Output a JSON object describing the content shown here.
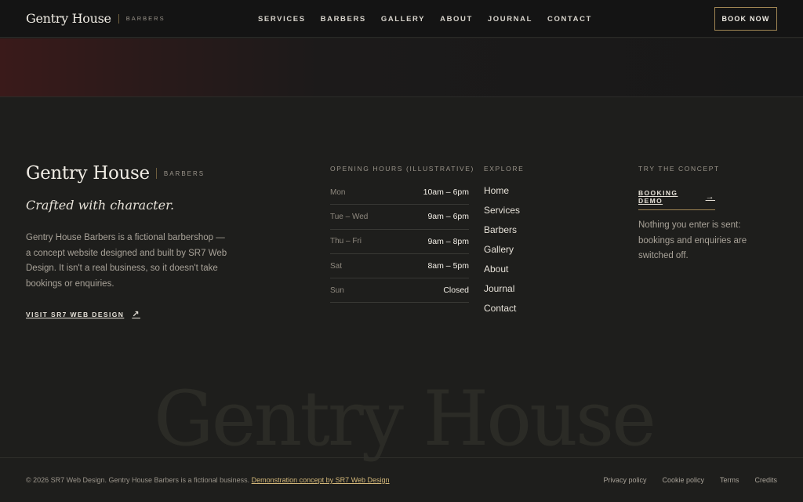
{
  "header": {
    "brand_name": "Gentry House",
    "brand_sub": "BARBERS",
    "nav": [
      "SERVICES",
      "BARBERS",
      "GALLERY",
      "ABOUT",
      "JOURNAL",
      "CONTACT"
    ],
    "book_label": "BOOK NOW"
  },
  "footer": {
    "brand_name": "Gentry House",
    "brand_sub": "BARBERS",
    "tagline": "Crafted with character.",
    "about": "Gentry House Barbers is a fictional barbershop — a concept website designed and built by SR7 Web Design. It isn't a real business, so it doesn't take bookings or enquiries.",
    "visit_label": "VISIT SR7 WEB DESIGN",
    "hours_title": "OPENING HOURS (ILLUSTRATIVE)",
    "hours": [
      {
        "day": "Mon",
        "time": "10am – 6pm"
      },
      {
        "day": "Tue – Wed",
        "time": "9am – 6pm"
      },
      {
        "day": "Thu – Fri",
        "time": "9am – 8pm"
      },
      {
        "day": "Sat",
        "time": "8am – 5pm"
      },
      {
        "day": "Sun",
        "time": "Closed"
      }
    ],
    "explore_title": "EXPLORE",
    "explore": [
      "Home",
      "Services",
      "Barbers",
      "Gallery",
      "About",
      "Journal",
      "Contact"
    ],
    "concept_title": "TRY THE CONCEPT",
    "demo_label": "BOOKING DEMO",
    "concept_note": "Nothing you enter is sent: bookings and enquiries are switched off.",
    "watermark": "Gentry House"
  },
  "bottom": {
    "copyright": "© 2026 SR7 Web Design. Gentry House Barbers is a fictional business.",
    "demo_link": "Demonstration concept by SR7 Web Design",
    "legal": [
      "Privacy policy",
      "Cookie policy",
      "Terms",
      "Credits"
    ]
  },
  "icons": {
    "visit": "arrow-up-right-icon",
    "demo": "arrow-right-icon"
  },
  "colors": {
    "accent": "#a08654",
    "background": "#1e1e1c",
    "header": "#141414"
  }
}
